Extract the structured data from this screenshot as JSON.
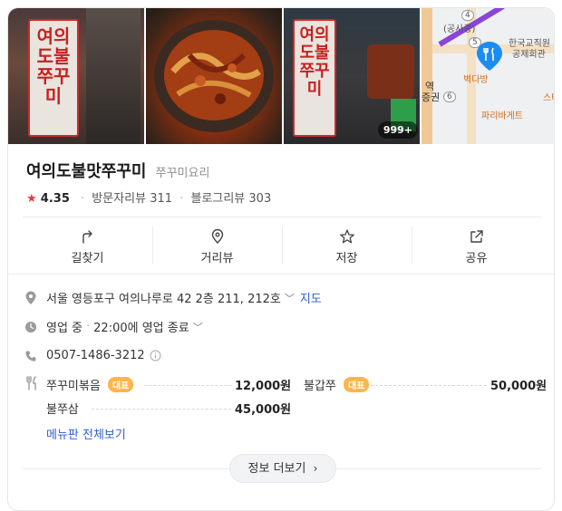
{
  "photos": {
    "banner_text_1": "여의도불쭈꾸미",
    "banner_text_2": "여의도불쭈꾸미",
    "banner_text_3": "여의도불쭈꾸미",
    "photo_count": "999+"
  },
  "map": {
    "exit_4": "4",
    "exit_5": "5",
    "exit_6": "6",
    "label_station": "(공사중)",
    "label_building": "한국교직원\n공제회관",
    "label_building_1": "한국교직원",
    "label_building_2": "공제회관",
    "label_pharmacy": "벽다방",
    "label_paris": "파리바게트",
    "label_station_name_1": "역",
    "label_station_name_2": "증권",
    "label_edge": "스타"
  },
  "place": {
    "name": "여의도불맛쭈꾸미",
    "category": "쭈꾸미요리",
    "rating": "4.35",
    "visitor_reviews": "방문자리뷰 311",
    "blog_reviews": "블로그리뷰 303"
  },
  "actions": [
    {
      "label": "길찾기",
      "icon": "directions-icon"
    },
    {
      "label": "거리뷰",
      "icon": "street-view-icon"
    },
    {
      "label": "저장",
      "icon": "star-icon"
    },
    {
      "label": "공유",
      "icon": "share-icon"
    }
  ],
  "info": {
    "address": "서울 영등포구 여의나루로 42 2층 211, 212호",
    "map_link": "지도",
    "status": "영업 중",
    "hours": "22:00에 영업 종료",
    "phone": "0507-1486-3212"
  },
  "menu": {
    "badge_label": "대표",
    "items": [
      {
        "name": "쭈꾸미볶음",
        "price": "12,000원",
        "featured": true
      },
      {
        "name": "불갑쭈",
        "price": "50,000원",
        "featured": true
      },
      {
        "name": "불쭈삼",
        "price": "45,000원",
        "featured": false
      }
    ],
    "view_all": "메뉴판 전체보기"
  },
  "more_button": "정보 더보기",
  "colors": {
    "accent_link": "#2d5fd3",
    "star": "#e5393d",
    "badge": "#ffb54a",
    "pin": "#1b8cf0"
  }
}
